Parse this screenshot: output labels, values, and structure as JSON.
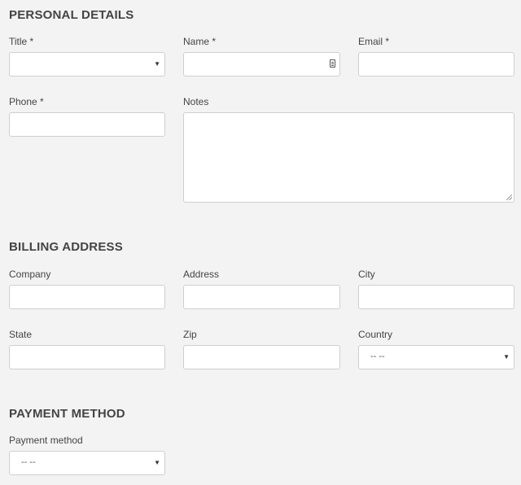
{
  "personal": {
    "heading": "PERSONAL DETAILS",
    "title_label": "Title *",
    "title_value": "",
    "name_label": "Name *",
    "email_label": "Email *",
    "phone_label": "Phone *",
    "notes_label": "Notes"
  },
  "billing": {
    "heading": "BILLING ADDRESS",
    "company_label": "Company",
    "address_label": "Address",
    "city_label": "City",
    "state_label": "State",
    "zip_label": "Zip",
    "country_label": "Country",
    "country_value": "-- --"
  },
  "payment": {
    "heading": "PAYMENT METHOD",
    "method_label": "Payment method",
    "method_value": "-- --"
  },
  "icons": {
    "select_caret": "chevron-down-icon",
    "contact_card": "contact-card-icon",
    "resize": "resize-grip-icon"
  }
}
